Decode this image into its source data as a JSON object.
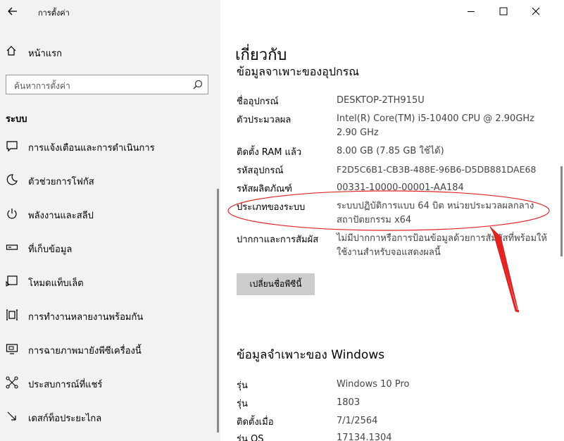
{
  "app": {
    "title": "การตั้งค่า"
  },
  "home": {
    "label": "หน้าแรก"
  },
  "search": {
    "placeholder": "ค้นหาการตั้งค่า"
  },
  "section": {
    "label": "ระบบ"
  },
  "nav": [
    {
      "label": "การแจ้งเตือนและการดำเนินการ",
      "icon": "notification-icon"
    },
    {
      "label": "ตัวช่วยการโฟกัส",
      "icon": "moon-icon"
    },
    {
      "label": "พลังงานและสลีป",
      "icon": "power-icon"
    },
    {
      "label": "ที่เก็บข้อมูล",
      "icon": "storage-icon"
    },
    {
      "label": "โหมดแท็บเล็ต",
      "icon": "tablet-icon"
    },
    {
      "label": "การทำงานหลายงานพร้อมกัน",
      "icon": "multitask-icon"
    },
    {
      "label": "การฉายภาพมายังพีซีเครื่องนี้",
      "icon": "projecting-icon"
    },
    {
      "label": "ประสบการณ์ที่แชร์",
      "icon": "shared-icon"
    },
    {
      "label": "เดสก์ท็อประยะไกล",
      "icon": "remote-desktop-icon"
    }
  ],
  "main": {
    "title": "เกี่ยวกับ",
    "device_section": "ข้อมูลจาเพาะของอุปกรณ",
    "specs": [
      {
        "key": "ชื่ออุปกรณ์",
        "value": "DESKTOP-2TH915U"
      },
      {
        "key": "ตัวประมวลผล",
        "value": "Intel(R) Core(TM) i5-10400 CPU @ 2.90GHz 2.90 GHz"
      },
      {
        "key": "ติดตั้ง RAM แล้ว",
        "value": "8.00 GB (7.85 GB ใช้ได้)"
      },
      {
        "key": "รหัสอุปกรณ์",
        "value": "F2D5C6B1-CB3B-488E-96B6-D5DB881DAE68"
      },
      {
        "key": "รหัสผลิตภัณฑ์",
        "value": "00331-10000-00001-AA184"
      },
      {
        "key": "ประเภทของระบบ",
        "value": "ระบบปฏิบัติการแบบ 64 บิต หน่วยประมวลผลกลางสถาปัตยกรรม x64"
      },
      {
        "key": "ปากกาและการสัมผัส",
        "value": "ไม่มีปากกาหรือการป้อนข้อมูลด้วยการสัมผัสที่พร้อมให้ใช้งานสำหรับจอแสดงผลนี้"
      }
    ],
    "rename_button": "เปลี่ยนชื่อพีซีนี้",
    "windows_section": "ข้อมูลจำเพาะของ Windows",
    "windows_specs": [
      {
        "key": "รุ่น",
        "value": "Windows 10 Pro"
      },
      {
        "key": "รุ่น",
        "value": "1803"
      },
      {
        "key": "ติดตั้งเมื่อ",
        "value": "7/1/2564"
      },
      {
        "key": "รุ่น OS",
        "value": "17134.1304"
      }
    ]
  },
  "colors": {
    "annotation": "#e02424",
    "sidebar_bg": "#f2f2f2",
    "button_bg": "#cccccc"
  }
}
